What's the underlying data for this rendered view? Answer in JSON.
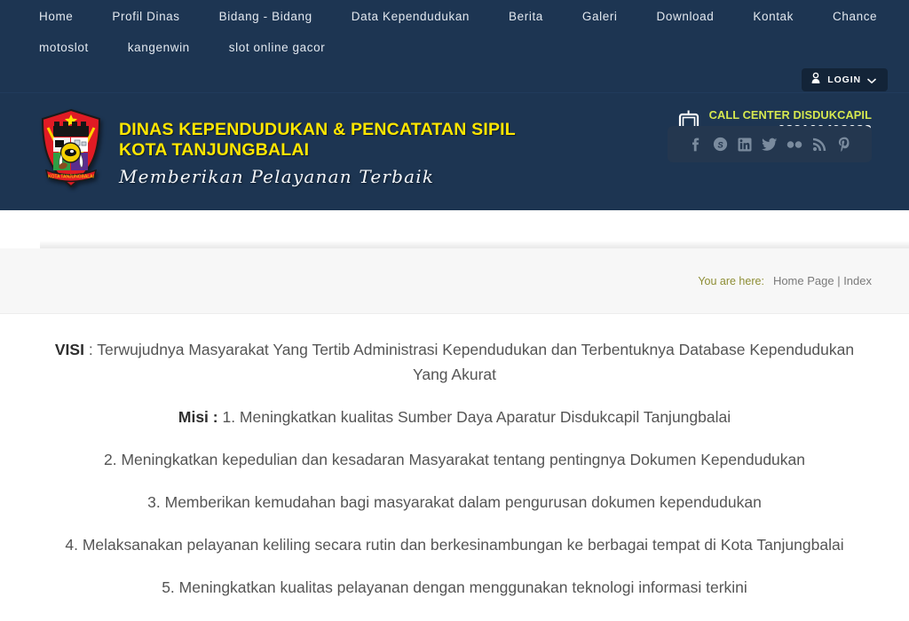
{
  "nav": {
    "row1": [
      {
        "label": "Home",
        "name": "nav-home"
      },
      {
        "label": "Profil Dinas",
        "name": "nav-profil-dinas"
      },
      {
        "label": "Bidang - Bidang",
        "name": "nav-bidang-bidang"
      },
      {
        "label": "Data Kependudukan",
        "name": "nav-data-kependudukan"
      },
      {
        "label": "Berita",
        "name": "nav-berita"
      },
      {
        "label": "Galeri",
        "name": "nav-galeri"
      },
      {
        "label": "Download",
        "name": "nav-download"
      },
      {
        "label": "Kontak",
        "name": "nav-kontak"
      },
      {
        "label": "Chance",
        "name": "nav-chance"
      }
    ],
    "row2": [
      {
        "label": "motoslot",
        "name": "nav-motoslot"
      },
      {
        "label": "kangenwin",
        "name": "nav-kangenwin"
      },
      {
        "label": "slot online gacor",
        "name": "nav-slot-online-gacor"
      }
    ],
    "login_label": "LOGIN"
  },
  "brand": {
    "line1": "DINAS KEPENDUDUKAN & PENCATATAN SIPIL",
    "line2": "KOTA TANJUNGBALAI",
    "tagline": "Memberikan Pelayanan Terbaik",
    "crest_caption": "KOTA TANJUNGBALAI"
  },
  "call_center": {
    "title": "CALL CENTER DISDUKCAPIL",
    "number": "082160498682"
  },
  "social": [
    {
      "name": "facebook-icon",
      "label": "Facebook"
    },
    {
      "name": "skype-icon",
      "label": "Skype"
    },
    {
      "name": "linkedin-icon",
      "label": "LinkedIn"
    },
    {
      "name": "twitter-icon",
      "label": "Twitter"
    },
    {
      "name": "flickr-icon",
      "label": "Flickr"
    },
    {
      "name": "rss-icon",
      "label": "RSS"
    },
    {
      "name": "pinterest-icon",
      "label": "Pinterest"
    }
  ],
  "breadcrumb": {
    "label": "You are here:",
    "path": "Home Page | Index"
  },
  "content": {
    "visi_label": "VISI",
    "visi_text": " : Terwujudnya Masyarakat Yang Tertib Administrasi Kependudukan dan Terbentuknya Database Kependudukan Yang Akurat",
    "misi_label": "Misi :",
    "misi_1": " 1. Meningkatkan kualitas Sumber Daya Aparatur Disdukcapil Tanjungbalai",
    "misi_2": "2. Meningkatkan kepedulian dan kesadaran Masyarakat tentang pentingnya Dokumen Kependudukan",
    "misi_3": "3. Memberikan kemudahan bagi masyarakat dalam pengurusan dokumen kependudukan",
    "misi_4": "4. Melaksanakan pelayanan keliling secara rutin dan berkesinambungan ke berbagai tempat di Kota Tanjungbalai",
    "misi_5": "5. Meningkatkan kualitas pelayanan dengan menggunakan teknologi informasi terkini"
  },
  "colors": {
    "header_blue": "#1d3552",
    "brand_yellow": "#ffe600",
    "call_title_green": "#d6e84f",
    "crumb_label": "#8d8d34",
    "social_panel": "#24374f"
  }
}
